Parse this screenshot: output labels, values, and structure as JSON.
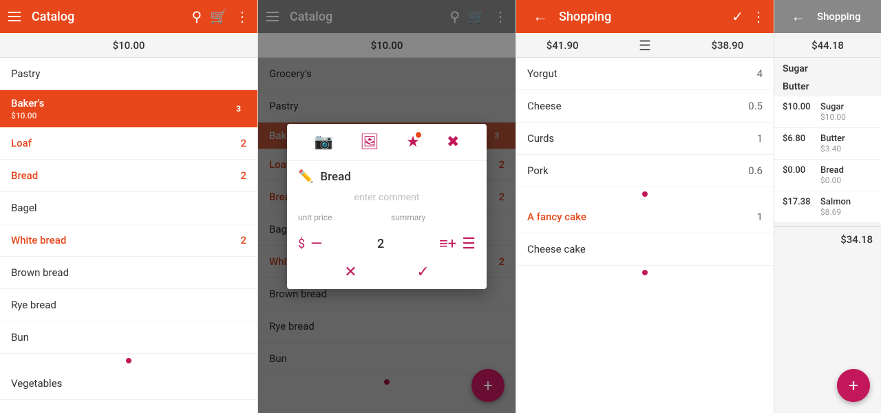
{
  "panel1": {
    "header": {
      "title": "Catalog",
      "budget": "$10.00"
    },
    "sections": [
      {
        "name": "Pastry",
        "badge": null,
        "price": null,
        "active": false
      },
      {
        "name": "Baker's",
        "badge": "3",
        "price": "$10.00",
        "active": true
      }
    ],
    "items": [
      {
        "name": "Loaf",
        "count": "2",
        "orange": true
      },
      {
        "name": "Bread",
        "count": "2",
        "orange": true
      },
      {
        "name": "Bagel",
        "count": null,
        "orange": false
      },
      {
        "name": "White bread",
        "count": "2",
        "orange": true
      },
      {
        "name": "Brown bread",
        "count": null,
        "orange": false
      },
      {
        "name": "Rye bread",
        "count": null,
        "orange": false
      },
      {
        "name": "Bun",
        "count": null,
        "orange": false
      }
    ],
    "bottom_section": {
      "name": "Vegetables",
      "badge": null
    },
    "fab_icon": "+"
  },
  "panel2": {
    "header": {
      "title": "Catalog",
      "budget": "$10.00"
    },
    "sections": [
      {
        "name": "Grocery's",
        "active": false
      },
      {
        "name": "Pastry",
        "active": false
      },
      {
        "name": "Baker's",
        "badge": "3",
        "active": true
      }
    ],
    "items": [
      {
        "name": "Loaf",
        "count": "2",
        "orange": true
      },
      {
        "name": "Bread",
        "count": "2",
        "orange": true
      },
      {
        "name": "Bagel",
        "count": null,
        "orange": false
      },
      {
        "name": "White bread",
        "count": "2",
        "orange": true
      },
      {
        "name": "Brown bread",
        "count": null,
        "orange": false
      },
      {
        "name": "Rye bread",
        "count": null,
        "orange": false
      },
      {
        "name": "Bun",
        "count": null,
        "orange": false
      }
    ],
    "dialog": {
      "title": "Bread",
      "comment_placeholder": "enter comment",
      "unit_price_label": "unit price",
      "summary_label": "summary",
      "quantity": "2",
      "icons": [
        "camera",
        "image",
        "bookmark",
        "delete"
      ]
    },
    "fab_icon": "+"
  },
  "panel3": {
    "header": {
      "title": "Shopping",
      "amount1": "$41.90",
      "amount2": "$38.90"
    },
    "items": [
      {
        "name": "Yorgut",
        "qty": "4",
        "orange": false
      },
      {
        "name": "Cheese",
        "qty": "0.5",
        "orange": false
      },
      {
        "name": "Curds",
        "qty": "1",
        "orange": false
      },
      {
        "name": "Pork",
        "qty": "0.6",
        "orange": false
      },
      {
        "name": "A fancy cake",
        "qty": "1",
        "orange": true
      },
      {
        "name": "Cheese cake",
        "qty": null,
        "orange": false
      }
    ]
  },
  "panel4": {
    "header": {
      "title": "Shopping",
      "amount": "$44.18"
    },
    "category_name": "Sugar",
    "items_top": [
      {
        "name": "Sugar",
        "price": null
      },
      {
        "name": "Butter",
        "price": null
      }
    ],
    "summary_rows": [
      {
        "price": "$10.00",
        "label": "Sugar",
        "sub": "$10.00"
      },
      {
        "price": "$6.80",
        "label": "Butter",
        "sub": "$3.40"
      },
      {
        "price": "$0.00",
        "label": "Bread",
        "sub": "$0.00"
      },
      {
        "price": "$17.38",
        "label": "Salmon",
        "sub": "$8.69"
      }
    ],
    "total": "$34.18"
  }
}
